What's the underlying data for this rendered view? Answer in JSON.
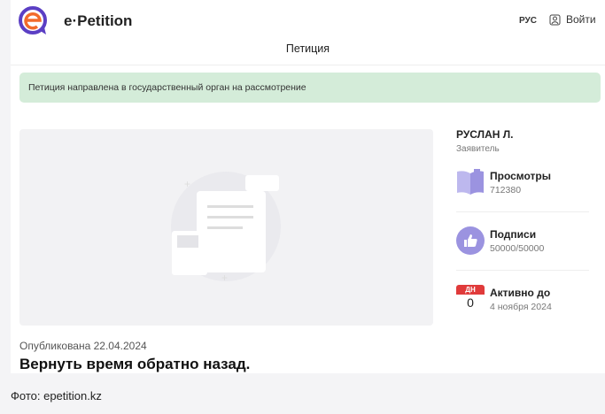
{
  "header": {
    "brand": "e·Petition",
    "lang": "РУС",
    "login": "Войти"
  },
  "subtitle": "Петиция",
  "banner": "Петиция направлена в государственный орган на рассмотрение",
  "petition": {
    "published": "Опубликована 22.04.2024",
    "title": "Вернуть время обратно назад."
  },
  "sidebar": {
    "author": "РУСЛАН Л.",
    "role": "Заявитель",
    "views_label": "Просмотры",
    "views": "712380",
    "signatures_label": "Подписи",
    "signatures": "50000/50000",
    "days_badge": "ДН",
    "days": "0",
    "active_label": "Активно до",
    "active_until": "4 ноября 2024"
  },
  "caption": "Фото: epetition.kz",
  "colors": {
    "banner": "#d4ecd9",
    "accent": "#9b93e0",
    "red": "#e03a3a",
    "logo_orange": "#f26b2b",
    "logo_purple": "#5b3fc4"
  }
}
